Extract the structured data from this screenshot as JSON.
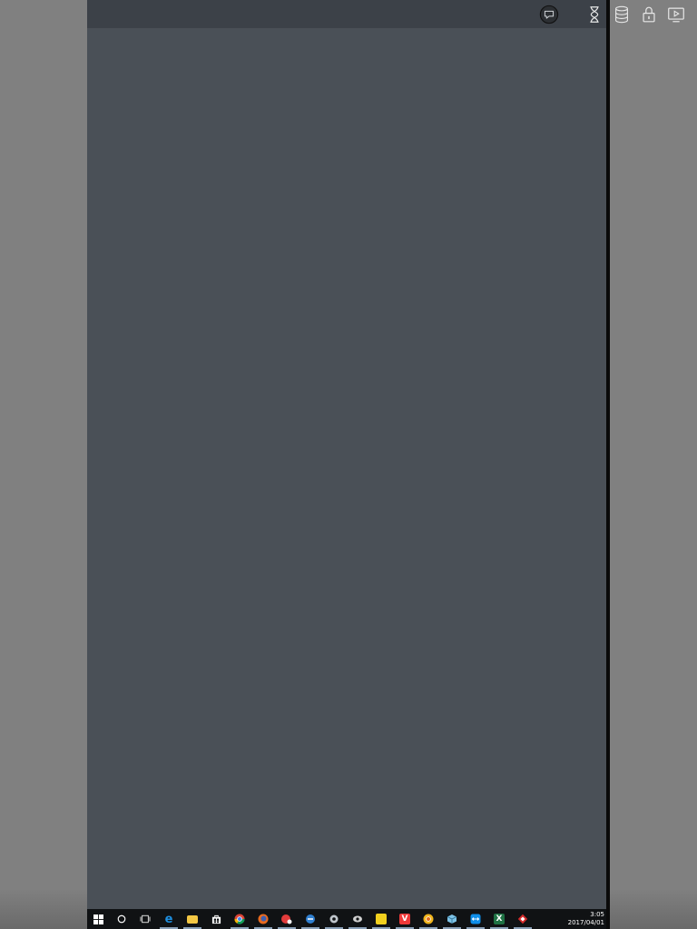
{
  "toolbar": {
    "icons": [
      {
        "name": "chat-bubble-icon"
      },
      {
        "name": "hourglass-icon"
      },
      {
        "name": "database-icon"
      },
      {
        "name": "lock-icon"
      },
      {
        "name": "screen-play-icon"
      }
    ]
  },
  "taskbar": {
    "clock": {
      "time": "3:05",
      "date": "2017/04/01"
    },
    "items": [
      {
        "name": "start-icon",
        "color": "#ffffff"
      },
      {
        "name": "cortana-icon",
        "color": "#ffffff"
      },
      {
        "name": "task-view-icon",
        "color": "#ffffff"
      },
      {
        "name": "edge-icon",
        "color": "#1e8fe0"
      },
      {
        "name": "file-explorer-icon",
        "color": "#f3c744"
      },
      {
        "name": "store-icon",
        "color": "#ffffff"
      },
      {
        "name": "chrome-icon",
        "color": "#e8b41a"
      },
      {
        "name": "firefox-icon",
        "color": "#e86a1f"
      },
      {
        "name": "app-red-icon",
        "color": "#e23b3b"
      },
      {
        "name": "app-blue-icon",
        "color": "#2f7fd0"
      },
      {
        "name": "app-gear-icon",
        "color": "#c0c6cc"
      },
      {
        "name": "app-eye-icon",
        "color": "#d0d0d0"
      },
      {
        "name": "app-yellow-icon",
        "color": "#f1d01e"
      },
      {
        "name": "vivaldi-icon",
        "color": "#ef3939"
      },
      {
        "name": "chrome-canary-icon",
        "color": "#f0b41c"
      },
      {
        "name": "app-cube-icon",
        "color": "#7ec3e6"
      },
      {
        "name": "teamviewer-icon",
        "color": "#0e8ee9"
      },
      {
        "name": "excel-icon",
        "color": "#1f7244"
      },
      {
        "name": "app-diamond-icon",
        "color": "#d42a2a"
      }
    ],
    "accent": "#8aa0b8"
  }
}
